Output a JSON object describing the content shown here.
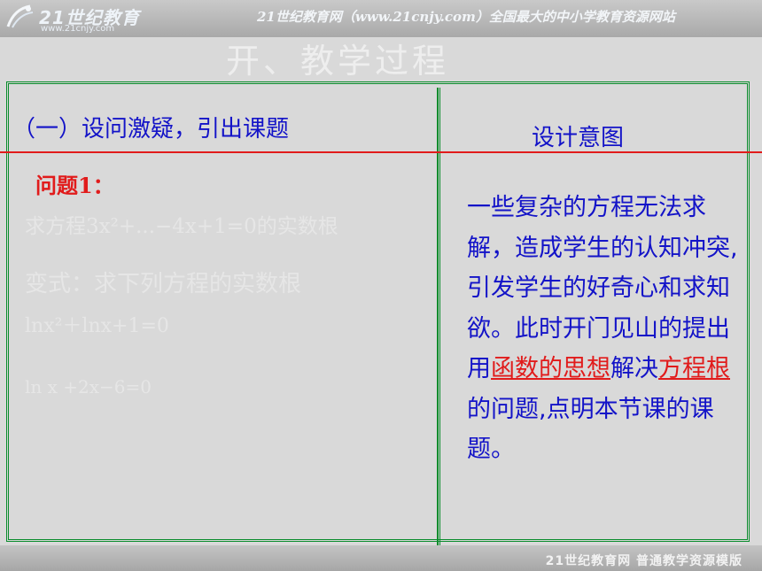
{
  "header": {
    "logo_text": "21世纪教育",
    "logo_url": "www.21cnjy.com",
    "banner": "21世纪教育网（www.21cnjy.com）全国最大的中小学教育资源网站"
  },
  "slide": {
    "background_title": "开、教学过程",
    "section_title": "（一）设问激疑，引出课题",
    "design_title": "设计意图",
    "problem_label": "问题1：",
    "faded_lines": [
      "求方程3x²+...−4x+1=0的实数根",
      "变式：求下列方程的实数根",
      "lnx²＋lnx+1=0",
      "ln x +2x−6=0"
    ],
    "design_text": {
      "part1": "一些复杂的方程无法求解，造成学生的认知冲突,引发学生的好奇心和求知欲。此时开门见山的提出用",
      "highlight1": "函数的思想",
      "part2": "解决",
      "highlight2": "方程根",
      "part3": "的问题,点明本节课的课题。"
    }
  },
  "footer": {
    "text": "21世纪教育网  普通教学资源模版"
  },
  "colors": {
    "blue_text": "#1313c8",
    "red_text": "#e11b1b",
    "green_border": "#0a8c2c",
    "background": "#d9d9d9"
  }
}
